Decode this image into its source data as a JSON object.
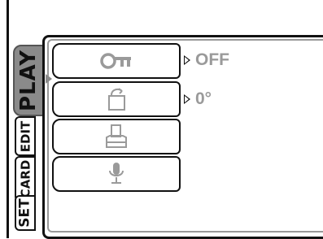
{
  "tabs": {
    "play": "PLAY",
    "edit": "EDIT",
    "card": "CARD",
    "set": "SET",
    "active": "PLAY"
  },
  "menu": {
    "items": [
      {
        "icon": "key-icon",
        "value": "OFF"
      },
      {
        "icon": "rotate-icon",
        "value": "0°"
      },
      {
        "icon": "print-icon",
        "value": ""
      },
      {
        "icon": "microphone-icon",
        "value": ""
      }
    ]
  },
  "colors": {
    "active_tab": "#8a8a8a",
    "icon_gray": "#9a9a9a",
    "value_gray": "#9a9a9a",
    "border": "#111111"
  }
}
